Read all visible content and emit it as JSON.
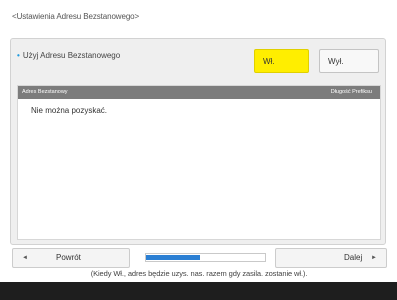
{
  "window": {
    "title": "<Ustawienia Adresu Bezstanowego>"
  },
  "setting": {
    "label": "Użyj Adresu Bezstanowego",
    "on_label": "Wł.",
    "off_label": "Wył.",
    "selected": "on"
  },
  "table": {
    "columns": [
      "Adres Bezstanowy",
      "Długość Prefiksu"
    ],
    "rows": [
      {
        "address": "Nie można pozyskać.",
        "prefix": ""
      }
    ]
  },
  "note": "(Kiedy Wł., adres będzie uzys. nas. razem gdy zasila. zostanie wł.).",
  "navigation": {
    "back_label": "Powrót",
    "next_label": "Dalej",
    "back_icon": "arrow-left-icon",
    "next_icon": "arrow-right-icon",
    "progress_fraction": 0.45
  },
  "colors": {
    "selected_button": "#ffee00",
    "accent_bullet": "#1e9be0",
    "progress_fill": "#2b7fd3",
    "header_gray": "#7c7c7c",
    "footer_bar": "#1e1e1e"
  }
}
